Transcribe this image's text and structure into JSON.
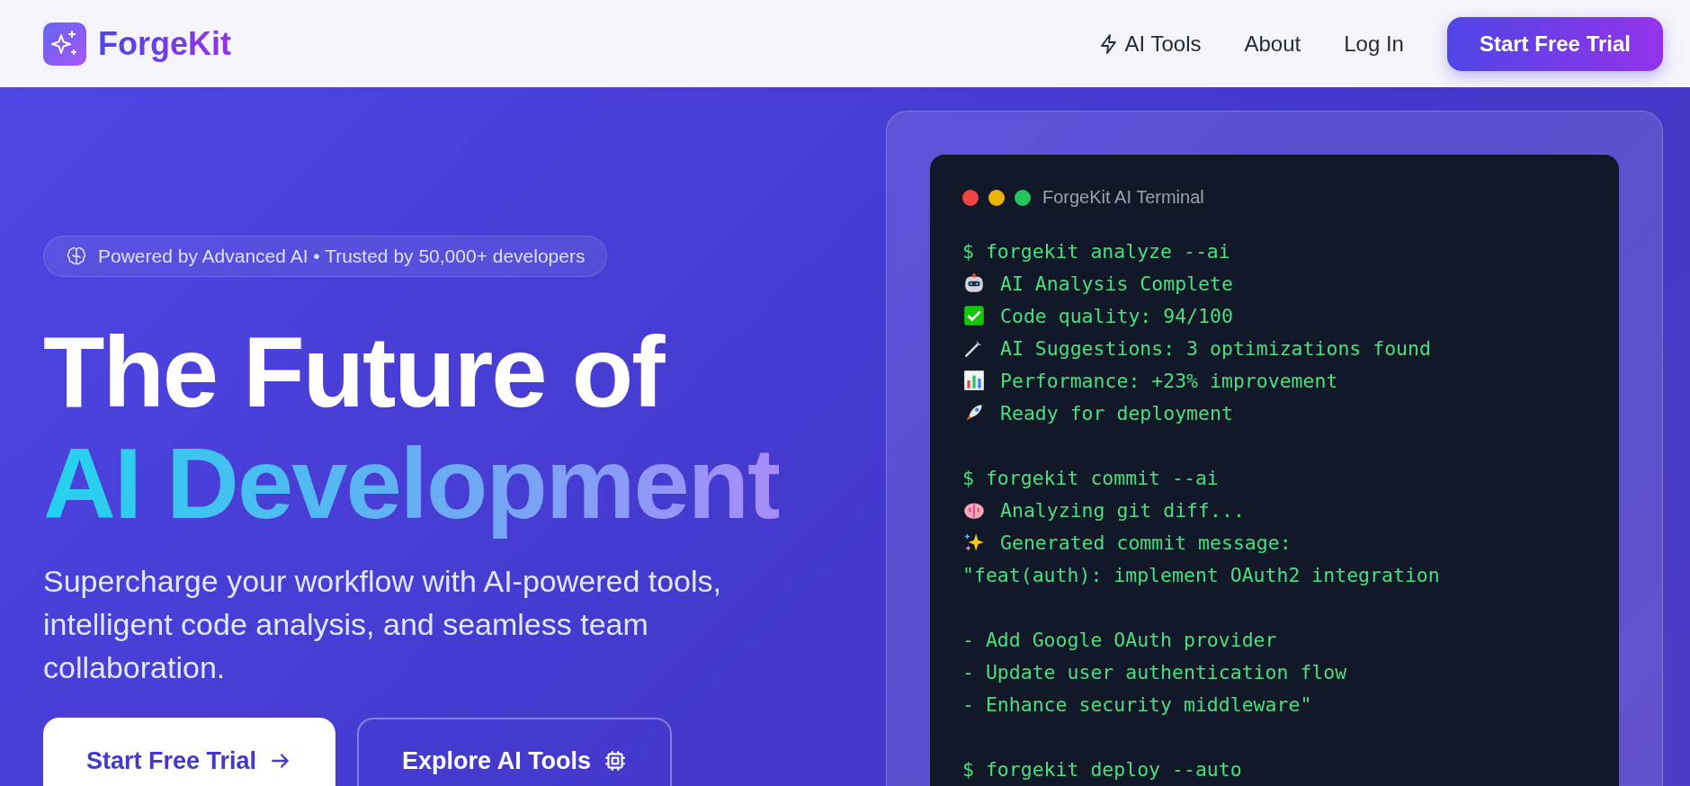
{
  "header": {
    "brand": "ForgeKit",
    "nav": [
      {
        "label": "AI Tools"
      },
      {
        "label": "About"
      },
      {
        "label": "Log In"
      }
    ],
    "cta": "Start Free Trial"
  },
  "hero": {
    "badge": "Powered by Advanced AI • Trusted by 50,000+ developers",
    "title_line_1": "The Future of",
    "title_line_2": "AI Development",
    "subtitle": "Supercharge your workflow with AI-powered tools, intelligent code analysis, and seamless team collaboration.",
    "buttons": [
      {
        "label": "Start Free Trial",
        "kind": "primary"
      },
      {
        "label": "Explore AI Tools",
        "kind": "outline"
      }
    ]
  },
  "terminal": {
    "title": "ForgeKit AI Terminal",
    "lines": [
      {
        "kind": "text",
        "text": "$ forgekit analyze --ai"
      },
      {
        "kind": "robot",
        "text": "AI Analysis Complete"
      },
      {
        "kind": "check",
        "text": "Code quality: 94/100"
      },
      {
        "kind": "wrench",
        "text": "AI Suggestions: 3 optimizations found"
      },
      {
        "kind": "chart",
        "text": "Performance: +23% improvement"
      },
      {
        "kind": "rocket",
        "text": "Ready for deployment"
      },
      {
        "kind": "blank"
      },
      {
        "kind": "text",
        "text": "$ forgekit commit --ai"
      },
      {
        "kind": "brain",
        "text": "Analyzing git diff..."
      },
      {
        "kind": "sparkles",
        "text": "Generated commit message:"
      },
      {
        "kind": "text",
        "text": "\"feat(auth): implement OAuth2 integration"
      },
      {
        "kind": "blank"
      },
      {
        "kind": "text",
        "text": "- Add Google OAuth provider"
      },
      {
        "kind": "text",
        "text": "- Update user authentication flow"
      },
      {
        "kind": "text",
        "text": "- Enhance security middleware\""
      },
      {
        "kind": "blank"
      },
      {
        "kind": "text",
        "text": "$ forgekit deploy --auto"
      }
    ]
  }
}
